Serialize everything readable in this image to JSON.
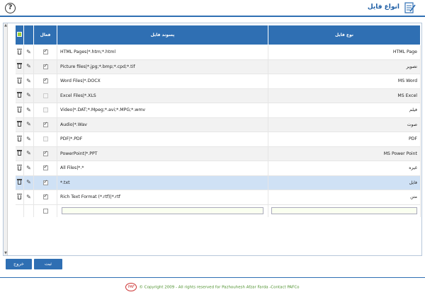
{
  "header": {
    "title": "انواع فایل",
    "help": "?"
  },
  "table": {
    "columns": {
      "enabled": "فعال",
      "extension": "پسوند فایل",
      "type": "نوع فایل"
    },
    "rows": [
      {
        "ext": "HTML Pages|*.htm;*.html",
        "type": "HTML Page",
        "checked": true
      },
      {
        "ext": "Picture files|*.jpg;*.bmp;*.cpd;*.tif",
        "type": "تصویر",
        "checked": true
      },
      {
        "ext": "Word Files|*.DOCX",
        "type": "MS Word",
        "checked": true
      },
      {
        "ext": "Excel Files|*.XLS",
        "type": "MS Excel",
        "checked": false
      },
      {
        "ext": "Video|*.DAT;*.Mpeg;*.avi;*.MPG;*.wmv",
        "type": "فیلم",
        "checked": false
      },
      {
        "ext": "Audio|*.Wav",
        "type": "صوت",
        "checked": true
      },
      {
        "ext": "PDF|*.PDF",
        "type": "PDF",
        "checked": false
      },
      {
        "ext": "PowerPoint|*.PPT",
        "type": "MS Power Point",
        "checked": true
      },
      {
        "ext": "All Files|*.*",
        "type": "غیره",
        "checked": true
      },
      {
        "ext": "*.txt",
        "type": "فایل",
        "checked": true
      },
      {
        "ext": "Rich Text Format (*.rtf)|*.rtf",
        "type": "متن",
        "checked": true
      }
    ]
  },
  "buttons": {
    "save": "ثبت",
    "exit": "خروج"
  },
  "footer": {
    "logo": "PAF",
    "text": "© Copyright 2009 - All rights reserved for Pazhouhesh Afzar Farda -Contact PAFCo"
  },
  "colors": {
    "accent": "#2f6fb3",
    "selected_row": "#cfe1f5",
    "footer_text": "#4a8f2a"
  }
}
